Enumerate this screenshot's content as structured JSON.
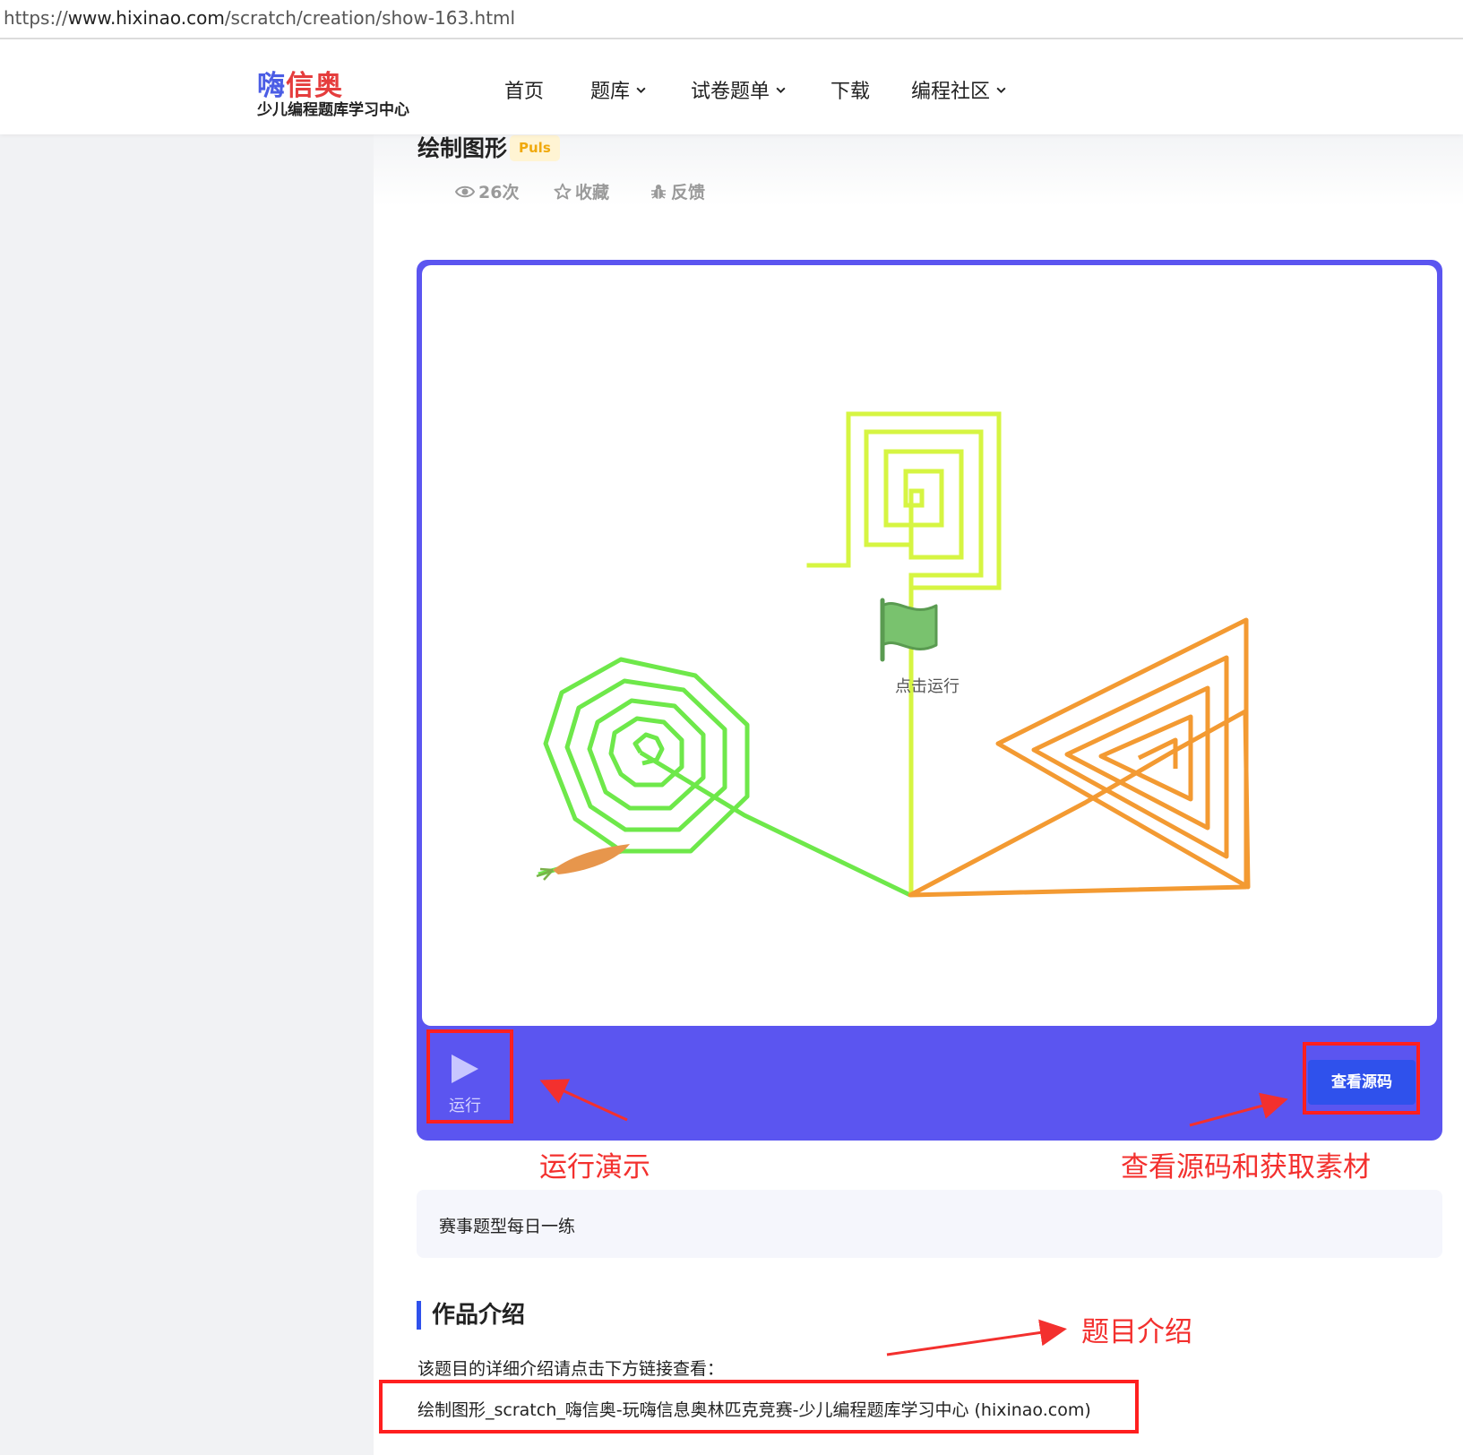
{
  "browser": {
    "url_scheme": "https://",
    "url_host": "www.hixinao.com",
    "url_path": "/scratch/creation/show-163.html"
  },
  "header": {
    "logo_part1": "嗨",
    "logo_part2": "信奥",
    "logo_subtitle": "少儿编程题库学习中心",
    "nav": [
      {
        "label": "首页",
        "has_dropdown": false
      },
      {
        "label": "题库",
        "has_dropdown": true
      },
      {
        "label": "试卷题单",
        "has_dropdown": true
      },
      {
        "label": "下载",
        "has_dropdown": false
      },
      {
        "label": "编程社区",
        "has_dropdown": true
      }
    ]
  },
  "work": {
    "title": "绘制图形",
    "badge": "Puls",
    "views": "26次",
    "favorite": "收藏",
    "feedback": "反馈"
  },
  "player": {
    "click_to_run": "点击运行",
    "run_label": "运行",
    "view_source_label": "查看源码"
  },
  "annotations": {
    "run_demo": "运行演示",
    "view_source": "查看源码和获取素材",
    "topic_intro": "题目介绍"
  },
  "description": {
    "box_text": "赛事题型每日一练",
    "section_title": "作品介绍",
    "intro_text": "该题目的详细介绍请点击下方链接查看：",
    "link_text": "绘制图形_scratch_嗨信奥-玩嗨信息奥林匹克竞赛-少儿编程题库学习中心 (hixinao.com)"
  },
  "colors": {
    "accent_blue": "#2f51ec",
    "player_purple": "#5b55f0",
    "annotation_red": "#f3302e",
    "badge_gold": "#f0a90c",
    "square_spiral": "#d6f542",
    "octagon_spiral": "#6ee84a",
    "triangle_spiral": "#f39a32",
    "flag_green": "#79c26e"
  },
  "icons": {
    "views": "eye-icon",
    "favorite": "star-icon",
    "feedback": "bug-icon",
    "flag": "green-flag-icon",
    "run": "play-icon",
    "sprite": "carrot-icon"
  }
}
